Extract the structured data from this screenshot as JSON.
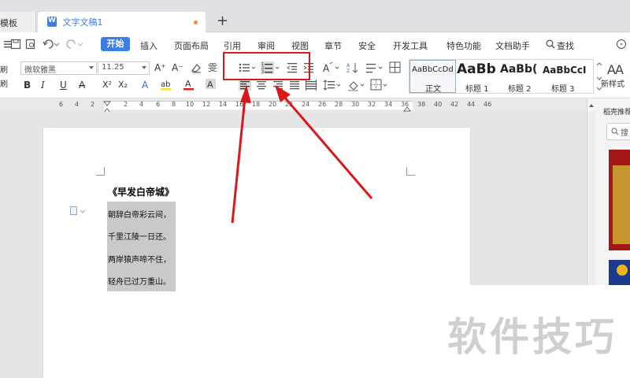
{
  "tabs": {
    "previous_tab": "模板",
    "active_tab": "文字文稿1",
    "new_tab_symbol": "+"
  },
  "menu": {
    "start": "开始",
    "items": [
      "插入",
      "页面布局",
      "引用",
      "审阅",
      "视图",
      "章节",
      "安全",
      "开发工具",
      "特色功能",
      "文档助手"
    ],
    "search_label": "查找"
  },
  "ribbon": {
    "font_name": "微软雅黑",
    "font_size": "11.25",
    "bold": "B",
    "italic": "I",
    "underline": "U",
    "strike": "A",
    "superscript": "X²",
    "subscript": "X₂",
    "grow_font": "A⁺",
    "shrink_font": "A⁻",
    "phonetic": "雯",
    "new_style_label": "新样式",
    "left_edge_label": "刷"
  },
  "styles": [
    {
      "sample": "AaBbCcDd",
      "name": "正文"
    },
    {
      "sample": "AaBb",
      "name": "标题 1"
    },
    {
      "sample": "AaBb(",
      "name": "标题 2"
    },
    {
      "sample": "AaBbCcI",
      "name": "标题 3"
    }
  ],
  "ruler": {
    "numbers": [
      "6",
      "4",
      "2",
      "2",
      "4",
      "6",
      "8",
      "10",
      "12",
      "14",
      "16",
      "18",
      "20",
      "22",
      "24",
      "26",
      "28",
      "30",
      "32",
      "34",
      "36",
      "38",
      "40",
      "42",
      "44",
      "46"
    ]
  },
  "document": {
    "title": "《早发白帝城》",
    "lines": [
      "朝辞白帝彩云间，",
      "千里江陵一日还。",
      "两岸猿声啼不住，",
      "轻舟已过万重山。"
    ]
  },
  "right_pane": {
    "title": "稻壳推荐",
    "search_placeholder": "搜"
  },
  "watermark": "软件技巧",
  "colors": {
    "accent": "#3b7fe6",
    "annotation_red": "#d8191c",
    "selection_gray": "#c9c9c9"
  }
}
